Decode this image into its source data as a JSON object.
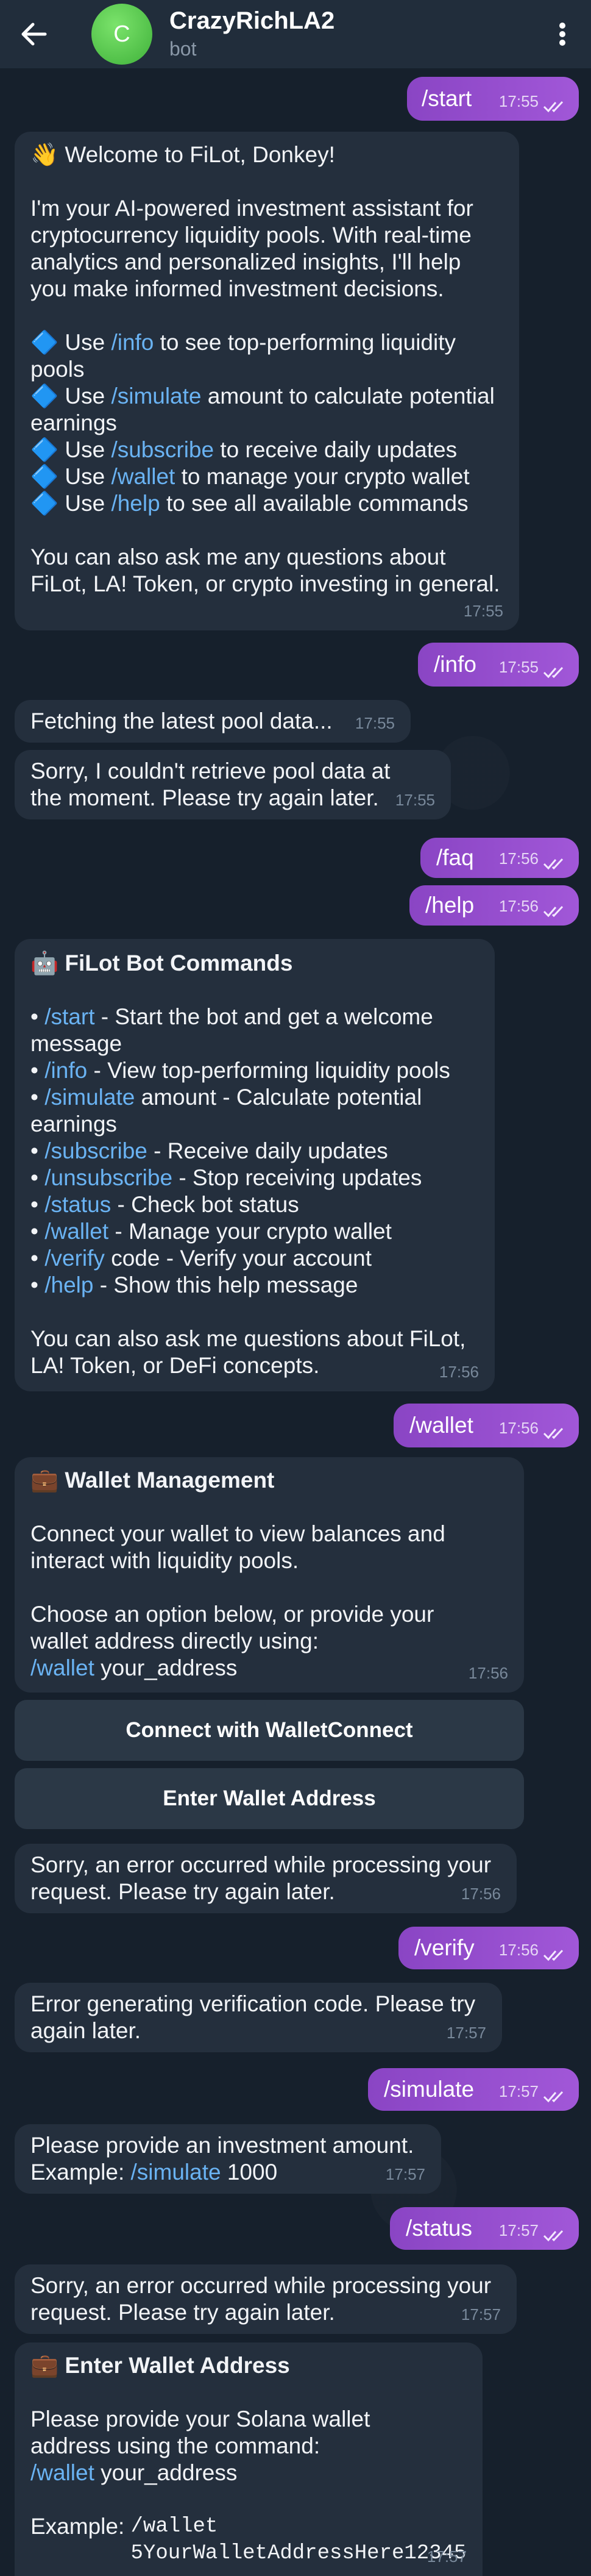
{
  "header": {
    "title": "CrazyRichLA2",
    "subtitle": "bot",
    "avatar_letter": "C"
  },
  "messages": {
    "m1": {
      "text": "/start",
      "time": "17:55"
    },
    "m2": {
      "line1": "👋 Welcome to FiLot, Donkey!",
      "para": "I'm your AI-powered investment assistant for cryptocurrency liquidity pools. With real-time analytics and personalized insights, I'll help you make informed investment decisions.",
      "i1_pre": "🔷 Use ",
      "i1_cmd": "/info",
      "i1_post": " to see top-performing liquidity pools",
      "i2_pre": "🔷 Use ",
      "i2_cmd": "/simulate",
      "i2_post": " amount to calculate potential earnings",
      "i3_pre": "🔷 Use ",
      "i3_cmd": "/subscribe",
      "i3_post": " to receive daily updates",
      "i4_pre": "🔷 Use ",
      "i4_cmd": "/wallet",
      "i4_post": " to manage your crypto wallet",
      "i5_pre": "🔷 Use ",
      "i5_cmd": "/help",
      "i5_post": " to see all available commands",
      "outro": "You can also ask me any questions about FiLot, LA! Token, or crypto investing in general.",
      "time": "17:55"
    },
    "m3": {
      "text": "/info",
      "time": "17:55"
    },
    "m4": {
      "text": "Fetching the latest pool data...",
      "time": "17:55"
    },
    "m5": {
      "text": "Sorry, I couldn't retrieve pool data at the moment. Please try again later.",
      "time": "17:55"
    },
    "m6": {
      "text": "/faq",
      "time": "17:56"
    },
    "m7": {
      "text": "/help",
      "time": "17:56"
    },
    "m8": {
      "title": "🤖 FiLot Bot Commands",
      "c1_cmd": "/start",
      "c1_desc": " - Start the bot and get a welcome message",
      "c2_cmd": "/info",
      "c2_desc": " - View top-performing liquidity pools",
      "c3_cmd": "/simulate",
      "c3_desc": " amount - Calculate potential earnings",
      "c4_cmd": "/subscribe",
      "c4_desc": " - Receive daily updates",
      "c5_cmd": "/unsubscribe",
      "c5_desc": " - Stop receiving updates",
      "c6_cmd": "/status",
      "c6_desc": " - Check bot status",
      "c7_cmd": "/wallet",
      "c7_desc": " - Manage your crypto wallet",
      "c8_cmd": "/verify",
      "c8_desc": " code - Verify your account",
      "c9_cmd": "/help",
      "c9_desc": " - Show this help message",
      "outro": "You can also ask me questions about FiLot, LA! Token, or DeFi concepts.",
      "bullet": "•",
      "time": "17:56"
    },
    "m9": {
      "text": "/wallet",
      "time": "17:56"
    },
    "m10": {
      "title": "💼 Wallet Management",
      "para1": "Connect your wallet to view balances and interact with liquidity pools.",
      "para2": "Choose an option below, or provide your wallet address directly using:",
      "cmd": "/wallet",
      "cmd_arg": " your_address",
      "time": "17:56"
    },
    "buttons": {
      "connect": "Connect with WalletConnect",
      "enter": "Enter Wallet Address"
    },
    "m11": {
      "text": "Sorry, an error occurred while processing your request. Please try again later.",
      "time": "17:56"
    },
    "m12": {
      "text": "/verify",
      "time": "17:56"
    },
    "m13": {
      "text": "Error generating verification code. Please try again later.",
      "time": "17:57"
    },
    "m14": {
      "text": "/simulate",
      "time": "17:57"
    },
    "m15": {
      "line1": "Please provide an investment amount.",
      "example_pre": "Example: ",
      "cmd": "/simulate",
      "example_post": " 1000",
      "time": "17:57"
    },
    "m16": {
      "text": "/status",
      "time": "17:57"
    },
    "m17": {
      "text": "Sorry, an error occurred while processing your request. Please try again later.",
      "time": "17:57"
    },
    "m18": {
      "title": "💼 Enter Wallet Address",
      "para": "Please provide your Solana wallet address using the command:",
      "cmd": "/wallet",
      "cmd_arg": " your_address",
      "example_label": "Example: ",
      "example_code": "/wallet\n5YourWalletAddressHere12345",
      "time": "17:57"
    }
  },
  "colors": {
    "background": "#16202c",
    "header": "#212d3b",
    "incoming_bubble": "#242f3d",
    "outgoing_bubble": "#9a50d2",
    "link": "#6ab3f3"
  },
  "icons": [
    "back-arrow-icon",
    "more-vertical-icon",
    "double-check-icon"
  ]
}
